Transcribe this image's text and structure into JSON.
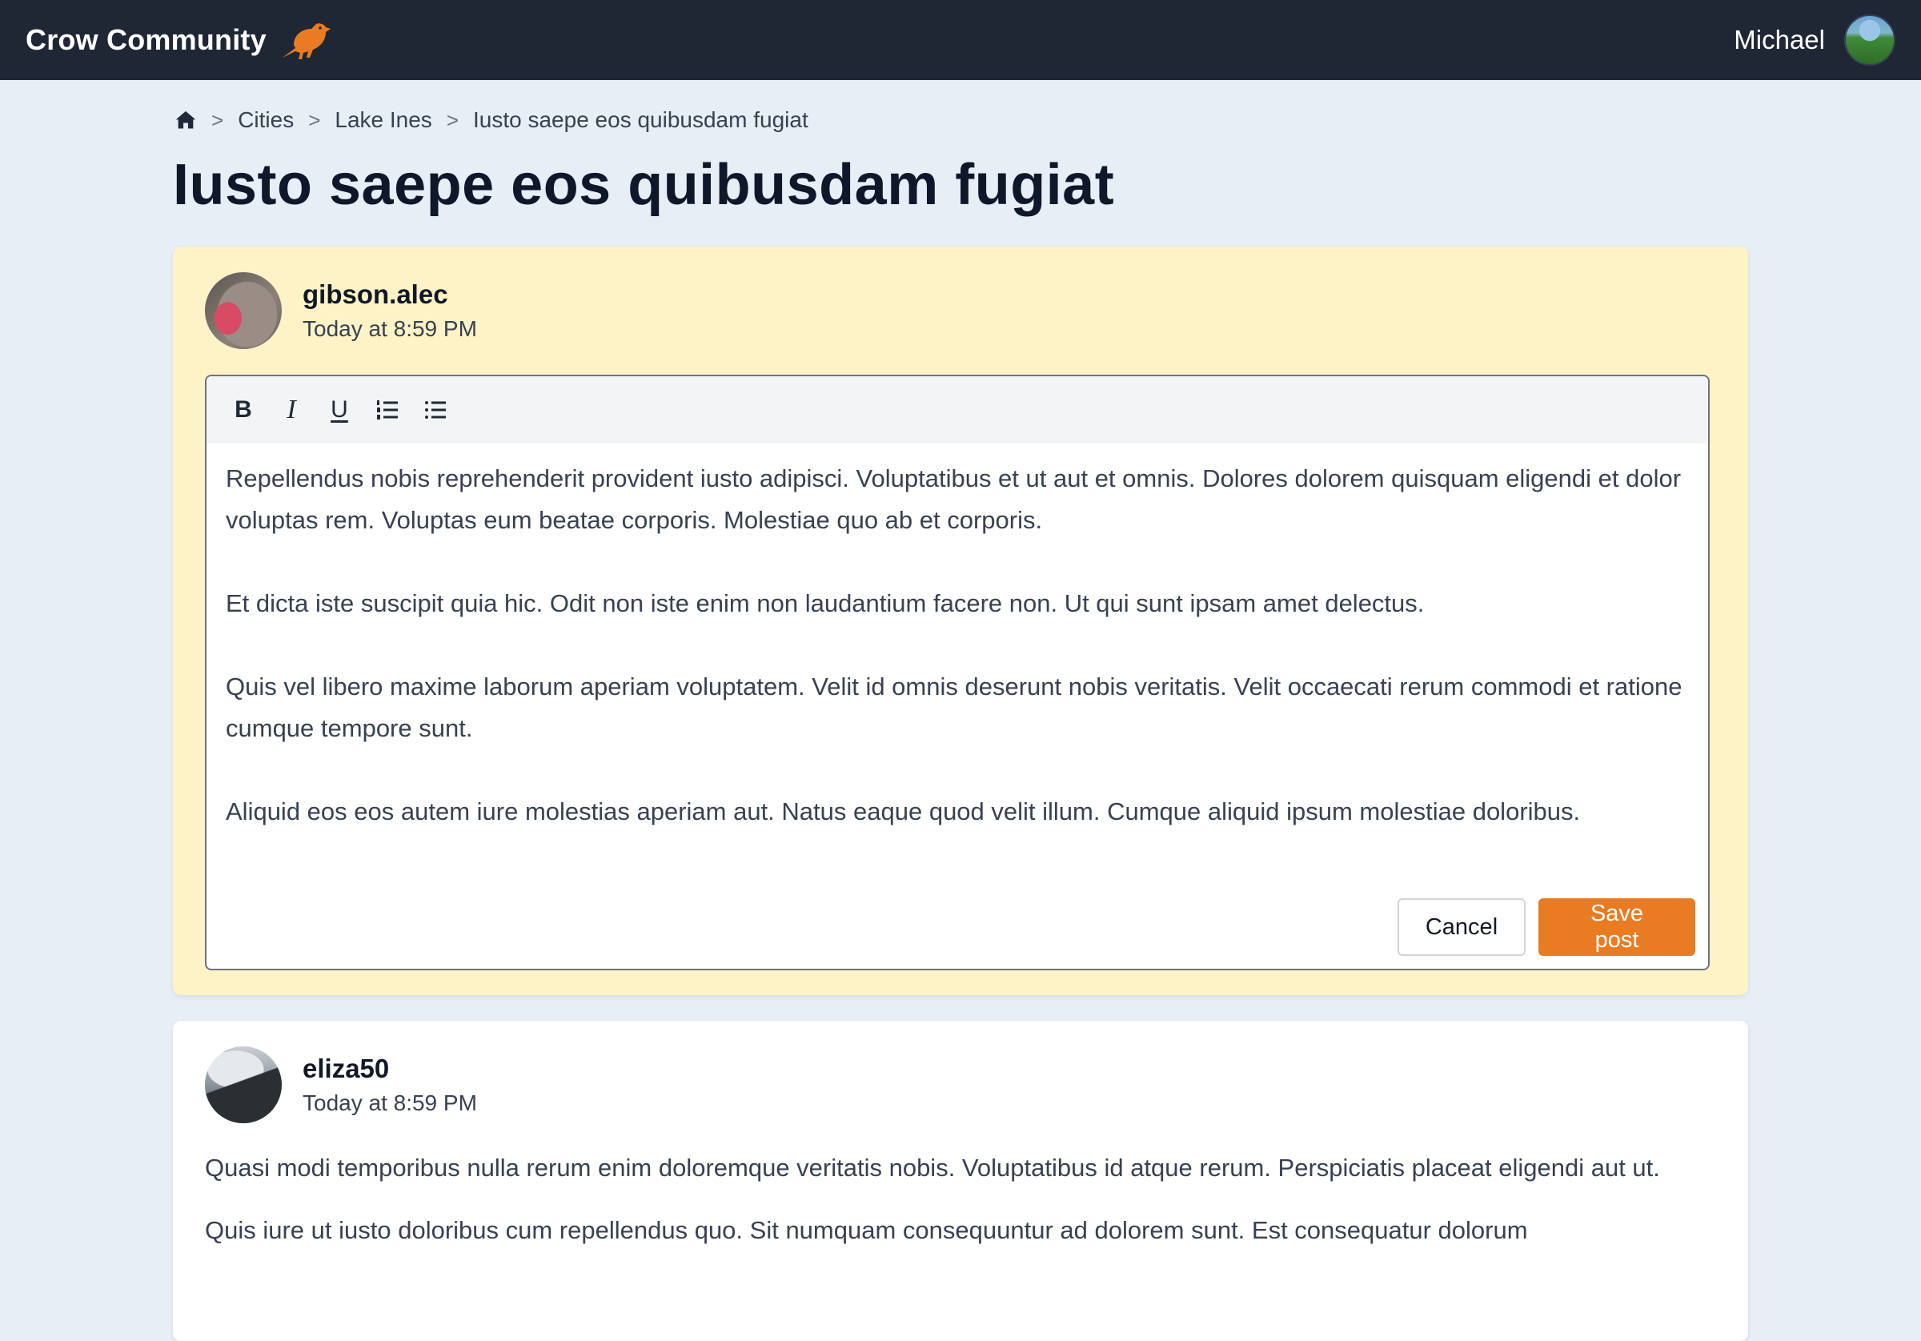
{
  "navbar": {
    "brand": "Crow Community",
    "logo_icon": "crow-icon",
    "user_name": "Michael"
  },
  "breadcrumb": {
    "home_icon": "home-icon",
    "separator": ">",
    "items": [
      "Cities",
      "Lake Ines",
      "Iusto saepe eos quibusdam fugiat"
    ]
  },
  "page_title": "Iusto saepe eos quibusdam fugiat",
  "editing_post": {
    "author": "gibson.alec",
    "time": "Today at 8:59 PM",
    "toolbar": {
      "bold": "B",
      "italic": "I",
      "underline": "U",
      "ordered_list_icon": "ordered-list-icon",
      "bullet_list_icon": "bullet-list-icon"
    },
    "paragraphs": [
      "Repellendus nobis reprehenderit provident iusto adipisci. Voluptatibus et ut aut et omnis. Dolores dolorem quisquam eligendi et dolor voluptas rem. Voluptas eum beatae corporis. Molestiae quo ab et corporis.",
      "Et dicta iste suscipit quia hic. Odit non iste enim non laudantium facere non. Ut qui sunt ipsam amet delectus.",
      "Quis vel libero maxime laborum aperiam voluptatem. Velit id omnis deserunt nobis veritatis. Velit occaecati rerum commodi et ratione cumque tempore sunt.",
      "Aliquid eos eos autem iure molestias aperiam aut. Natus eaque quod velit illum. Cumque aliquid ipsum molestiae doloribus."
    ],
    "cancel_label": "Cancel",
    "save_label": "Save post"
  },
  "second_post": {
    "author": "eliza50",
    "time": "Today at 8:59 PM",
    "paragraphs": [
      "Quasi modi temporibus nulla rerum enim doloremque veritatis nobis. Voluptatibus id atque rerum. Perspiciatis placeat eligendi aut ut.",
      "Quis iure ut iusto doloribus cum repellendus quo. Sit numquam consequuntur ad dolorem sunt. Est consequatur dolorum"
    ]
  },
  "colors": {
    "navbar_bg": "#1f2735",
    "page_bg": "#e7eef6",
    "editing_post_bg": "#fef3c7",
    "accent": "#e97c22"
  }
}
